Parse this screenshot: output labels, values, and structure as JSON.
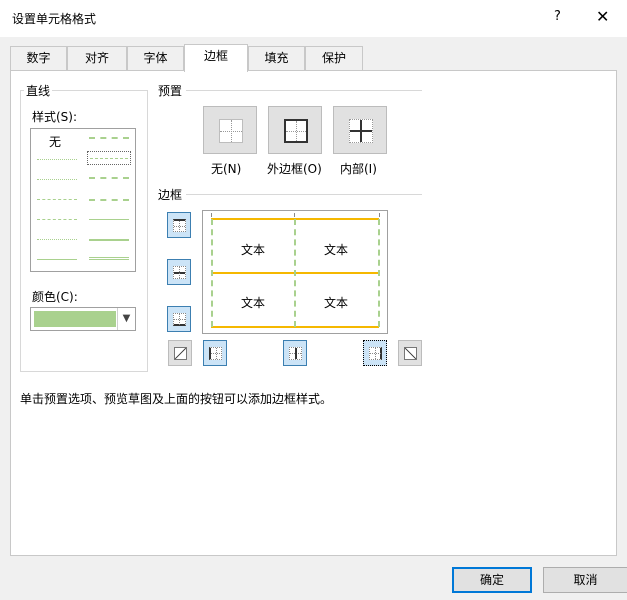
{
  "window": {
    "title": "设置单元格格式",
    "help": "?",
    "close": "✕"
  },
  "tabs": [
    {
      "label": "数字"
    },
    {
      "label": "对齐"
    },
    {
      "label": "字体"
    },
    {
      "label": "边框"
    },
    {
      "label": "填充"
    },
    {
      "label": "保护"
    }
  ],
  "line": {
    "section_label": "直线",
    "style_label": "样式(S):",
    "none_label": "无",
    "color_label": "颜色(C):",
    "color_value": "#a9d18e"
  },
  "presets": {
    "section_label": "预置",
    "items": [
      {
        "label": "无(N)"
      },
      {
        "label": "外边框(O)"
      },
      {
        "label": "内部(I)"
      }
    ]
  },
  "border": {
    "section_label": "边框",
    "preview_text": [
      "文本",
      "文本",
      "文本",
      "文本"
    ],
    "outer_color": "#f5b800",
    "inner_color": "#a9d18e"
  },
  "hint": "单击预置选项、预览草图及上面的按钮可以添加边框样式。",
  "footer": {
    "ok": "确定",
    "cancel": "取消"
  }
}
